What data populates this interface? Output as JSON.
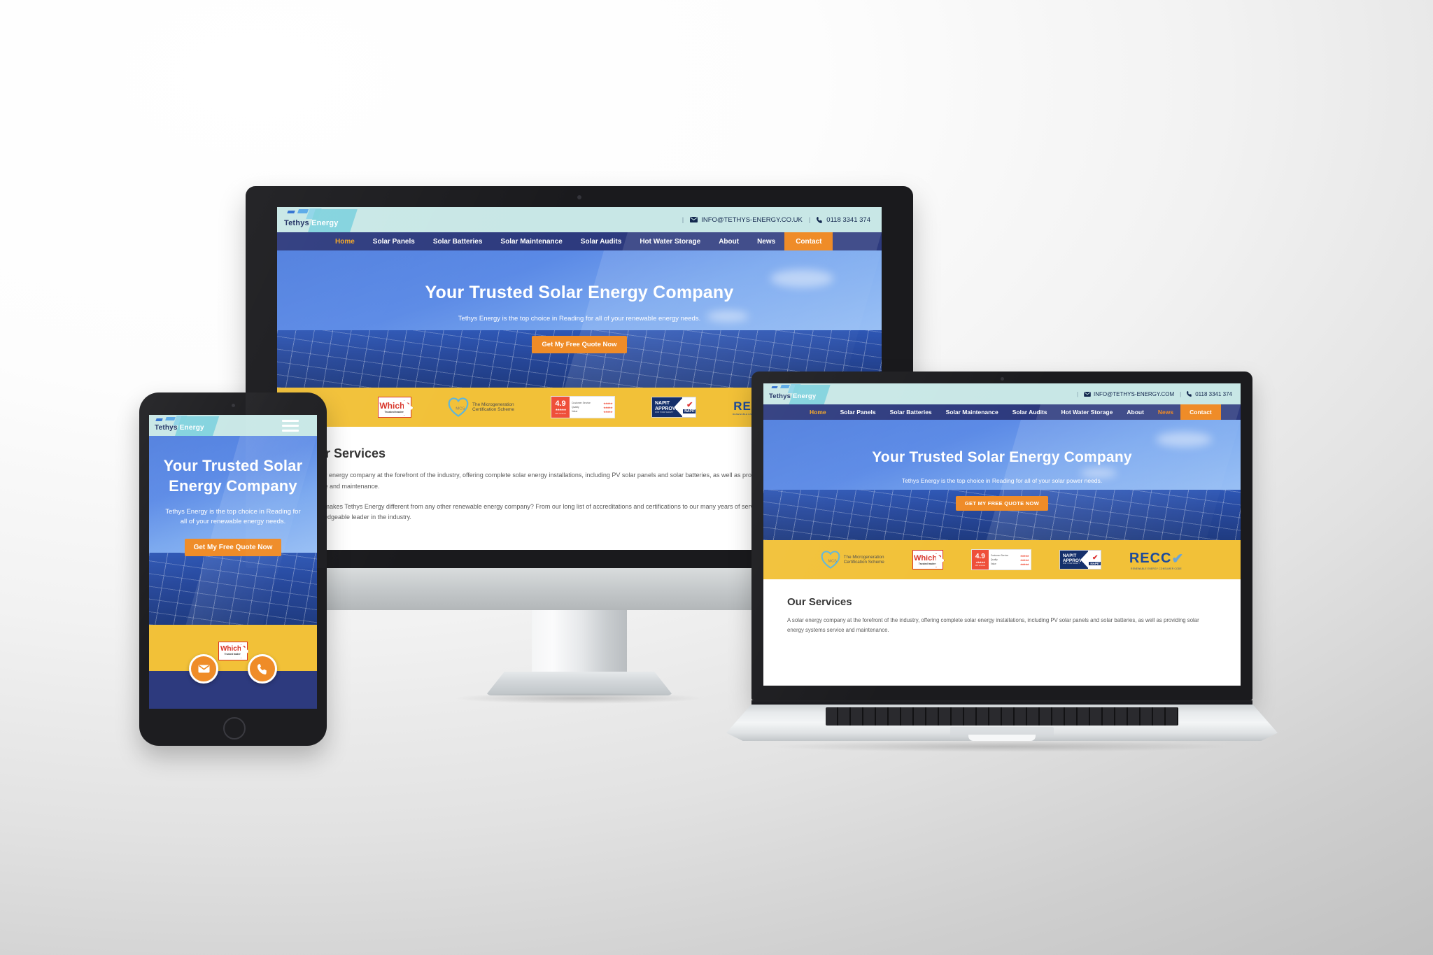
{
  "brand": {
    "name_part1": "Tethys",
    "name_part2": "Energy",
    "accent_orange": "#ef8c28",
    "navy": "#2d3a7e",
    "mint": "#c8e7e6",
    "yellow": "#f2c138",
    "hero_blue": "#3a62c4"
  },
  "desktop": {
    "contact": {
      "email": "INFO@TETHYS-ENERGY.CO.UK",
      "phone": "0118 3341 374",
      "mail_icon": "envelope-icon",
      "phone_icon": "phone-icon"
    },
    "nav": [
      {
        "label": "Home",
        "state": "active"
      },
      {
        "label": "Solar Panels",
        "state": ""
      },
      {
        "label": "Solar Batteries",
        "state": ""
      },
      {
        "label": "Solar Maintenance",
        "state": ""
      },
      {
        "label": "Solar Audits",
        "state": ""
      },
      {
        "label": "Hot Water Storage",
        "state": ""
      },
      {
        "label": "About",
        "state": ""
      },
      {
        "label": "News",
        "state": ""
      },
      {
        "label": "Contact",
        "state": "cta"
      }
    ],
    "hero": {
      "title": "Your Trusted Solar Energy Company",
      "subtitle": "Tethys Energy is the top choice in Reading for all of your renewable energy needs.",
      "cta": "Get My Free Quote Now"
    },
    "services": {
      "heading": "Our Services",
      "p1": "A solar energy company at the forefront of the industry, offering complete solar energy installations, including PV solar panels and solar batteries, as well as providing solar energy systems service and maintenance.",
      "p2": "What makes Tethys Energy different from any other renewable energy company? From our long list of accreditations and certifications to our many years of service, we are a trusted, proven, knowledgeable leader in the industry."
    }
  },
  "laptop": {
    "contact": {
      "email": "INFO@TETHYS-ENERGY.COM",
      "phone": "0118 3341 374"
    },
    "nav": [
      {
        "label": "Home",
        "state": "active"
      },
      {
        "label": "Solar Panels",
        "state": ""
      },
      {
        "label": "Solar Batteries",
        "state": ""
      },
      {
        "label": "Solar Maintenance",
        "state": ""
      },
      {
        "label": "Solar Audits",
        "state": ""
      },
      {
        "label": "Hot Water Storage",
        "state": ""
      },
      {
        "label": "About",
        "state": ""
      },
      {
        "label": "News",
        "state": "hover"
      },
      {
        "label": "Contact",
        "state": "cta"
      }
    ],
    "hero": {
      "title": "Your Trusted Solar Energy Company",
      "subtitle": "Tethys Energy is the top choice in Reading for all of your solar power needs.",
      "cta": "GET MY FREE QUOTE NOW"
    },
    "services": {
      "heading": "Our Services",
      "p1": "A solar energy company at the forefront of the industry, offering complete solar energy installations, including PV solar panels and solar batteries, as well as providing solar energy systems service and maintenance."
    }
  },
  "mobile": {
    "menu_icon": "hamburger-menu-icon",
    "hero": {
      "title": "Your Trusted Solar Energy Company",
      "subtitle": "Tethys Energy is the top choice in Reading for all of your renewable energy needs.",
      "cta": "Get My Free Quote Now"
    },
    "actions": [
      {
        "name": "email-fab",
        "icon": "envelope-icon",
        "glyph": "✉"
      },
      {
        "name": "phone-fab",
        "icon": "phone-icon",
        "glyph": "☎"
      }
    ]
  },
  "badges": {
    "which": {
      "word": "Which",
      "mark": "?",
      "sub": "Trusted traders"
    },
    "mcs": {
      "abbr": "MCS",
      "line1": "The Microgeneration",
      "line2": "Certification Scheme"
    },
    "reviews": {
      "score": "4.9",
      "stars": "★★★★★",
      "count": "118 reviews",
      "rows": [
        {
          "label": "Customer Service",
          "value": "4.9",
          "stars": "★★★★★"
        },
        {
          "label": "Quality",
          "value": "4.9",
          "stars": "★★★★★"
        },
        {
          "label": "Value",
          "value": "4.9",
          "stars": "★★★★★"
        }
      ]
    },
    "napit": {
      "line1": "NAPIT",
      "line2": "APPROVED",
      "sub": "FOR YOUR SAFETY",
      "word": "NAPIT",
      "tick": "✔"
    },
    "recc": {
      "word": "RECC",
      "tick": "✔",
      "sub": "RENEWABLE ENERGY CONSUMER CODE"
    }
  }
}
